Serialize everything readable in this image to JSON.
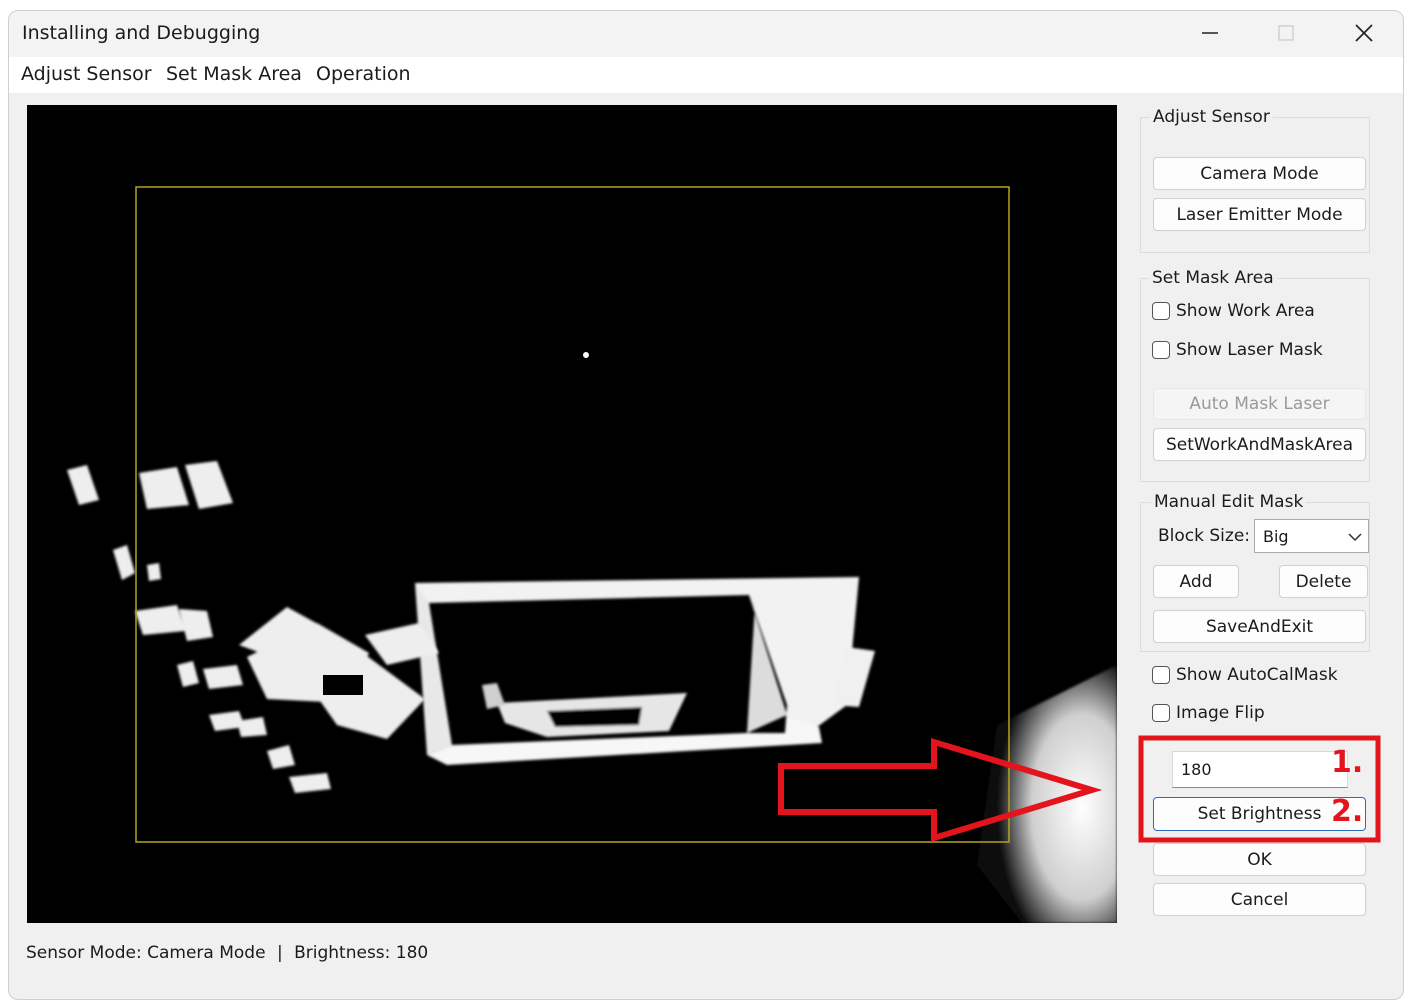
{
  "window": {
    "title": "Installing and Debugging"
  },
  "menu": {
    "items": [
      "Adjust Sensor",
      "Set Mask Area",
      "Operation"
    ]
  },
  "adjust_sensor": {
    "label": "Adjust Sensor",
    "camera_mode": "Camera Mode",
    "laser_emitter_mode": "Laser Emitter Mode"
  },
  "set_mask_area": {
    "label": "Set Mask Area",
    "show_work_area": "Show Work Area",
    "show_laser_mask": "Show Laser Mask",
    "auto_mask_laser": "Auto Mask Laser",
    "set_work_and_mask_area": "SetWorkAndMaskArea"
  },
  "manual_edit_mask": {
    "label": "Manual Edit Mask",
    "block_size_label": "Block Size:",
    "block_size_value": "Big",
    "add": "Add",
    "delete": "Delete",
    "save_and_exit": "SaveAndExit"
  },
  "options": {
    "show_autocalmask": "Show AutoCalMask",
    "image_flip": "Image Flip"
  },
  "brightness": {
    "value": "180",
    "set_label": "Set Brightness",
    "step1": "1.",
    "step2": "2."
  },
  "dialog": {
    "ok": "OK",
    "cancel": "Cancel"
  },
  "status": {
    "sensor_mode": "Sensor Mode: Camera Mode",
    "separator": "|",
    "brightness": "Brightness: 180"
  },
  "colors": {
    "annotation_red": "#e3141c",
    "work_area_outline": "#b5a31e"
  }
}
